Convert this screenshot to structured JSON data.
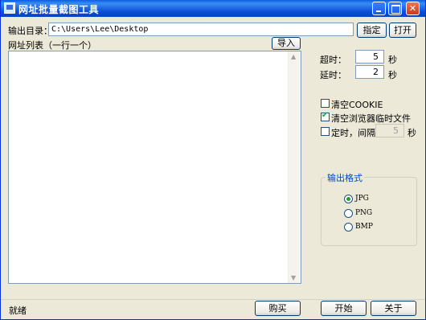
{
  "window": {
    "title": "网址批量截图工具"
  },
  "output": {
    "label": "输出目录：",
    "path": "C:\\Users\\Lee\\Desktop",
    "specify_label": "指定",
    "open_label": "打开"
  },
  "urllist": {
    "label": "网址列表（一行一个）",
    "import_label": "导入"
  },
  "timeout": {
    "label": "超时：",
    "value": "5",
    "unit": "秒"
  },
  "delay": {
    "label": "延时：",
    "value": "2",
    "unit": "秒"
  },
  "options": {
    "clear_cookie": {
      "label": "清空COOKIE",
      "checked": false
    },
    "clear_temp": {
      "label": "清空浏览器临时文件",
      "checked": true
    },
    "timer": {
      "label": "定时，间隔",
      "checked": false,
      "value": "5",
      "unit": "秒"
    }
  },
  "format": {
    "title": "输出格式",
    "options": [
      "JPG",
      "PNG",
      "BMP"
    ],
    "selected": "JPG"
  },
  "status": "就绪",
  "buttons": {
    "buy": "购买",
    "start": "开始",
    "about": "关于"
  }
}
